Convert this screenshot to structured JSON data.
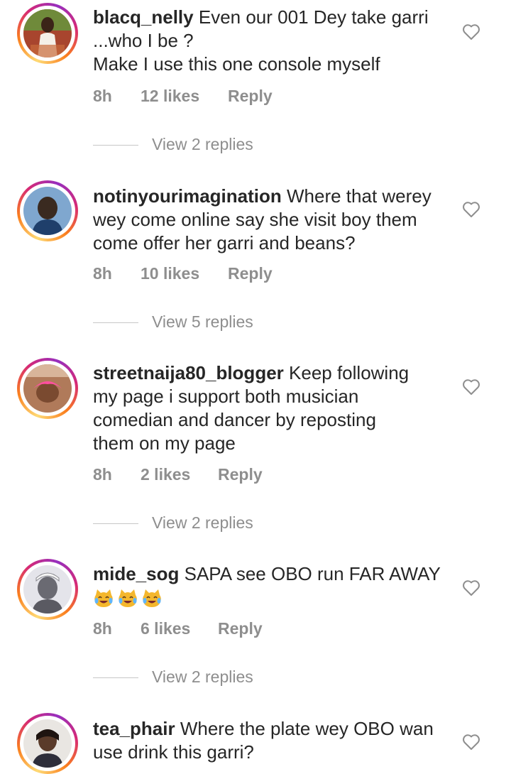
{
  "comments": [
    {
      "username": "blacq_nelly",
      "lines": [
        "Even our 001 Dey take garri",
        "...who I be ?",
        "Make I use this one console myself"
      ],
      "time": "8h",
      "likes": "12 likes",
      "reply": "Reply",
      "view_replies": "View 2 replies",
      "avatar_color": "#b5523b"
    },
    {
      "username": "notinyourimagination",
      "lines": [
        "Where that werey",
        "wey come online say she visit boy them",
        "come offer her garri and beans?"
      ],
      "time": "8h",
      "likes": "10 likes",
      "reply": "Reply",
      "view_replies": "View 5 replies",
      "avatar_color": "#3a5f8a"
    },
    {
      "username": "streetnaija80_blogger",
      "lines": [
        "Keep following",
        "my page i support both musician",
        "comedian and dancer by reposting",
        "them on my page"
      ],
      "time": "8h",
      "likes": "2 likes",
      "reply": "Reply",
      "view_replies": "View 2 replies",
      "avatar_color": "#c9896a"
    },
    {
      "username": "mide_sog",
      "lines": [
        "SAPA see OBO run FAR AWAY"
      ],
      "emoji_count": 3,
      "time": "8h",
      "likes": "6 likes",
      "reply": "Reply",
      "view_replies": "View 2 replies",
      "avatar_color": "#9a9aa5"
    },
    {
      "username": "tea_phair",
      "lines": [
        "Where the plate wey OBO wan",
        "use  drink this garri?"
      ],
      "avatar_color": "#6b4f3c"
    }
  ]
}
